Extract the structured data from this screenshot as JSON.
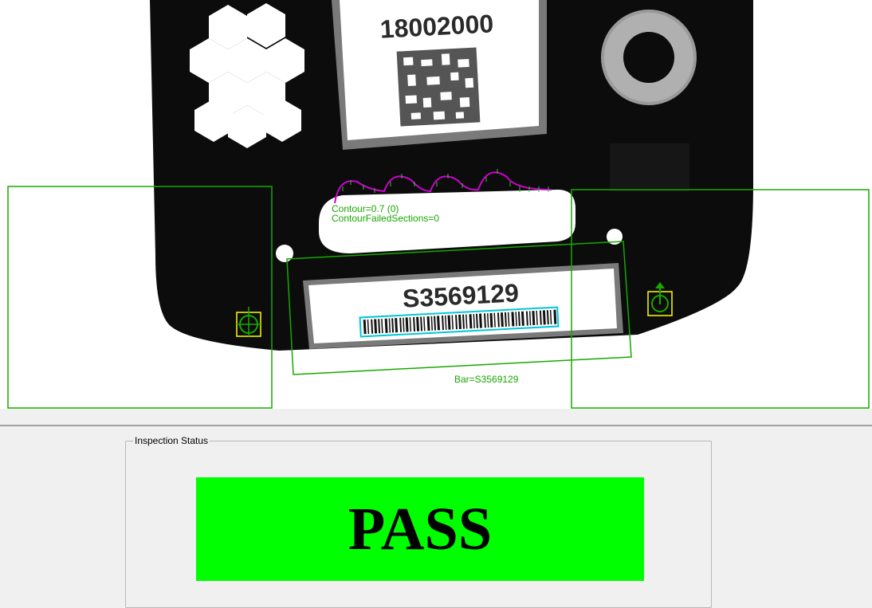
{
  "camera_view": {
    "label_top": "18002000",
    "label_bottom": "S3569129",
    "overlay": {
      "contour_result": "Contour=0.7 (0)",
      "contour_failed_sections": "ContourFailedSections=0",
      "barcode_result": "Bar=S3569129"
    },
    "colors": {
      "overlay_green": "#18a800",
      "contour_magenta": "#d000d0",
      "locator_yellow": "#ffff00",
      "barcode_cyan": "#00c8d8",
      "part_body": "#0c0c0c"
    }
  },
  "status_panel": {
    "group_title": "Inspection Status",
    "result": "PASS",
    "result_color": "#00ff00"
  }
}
